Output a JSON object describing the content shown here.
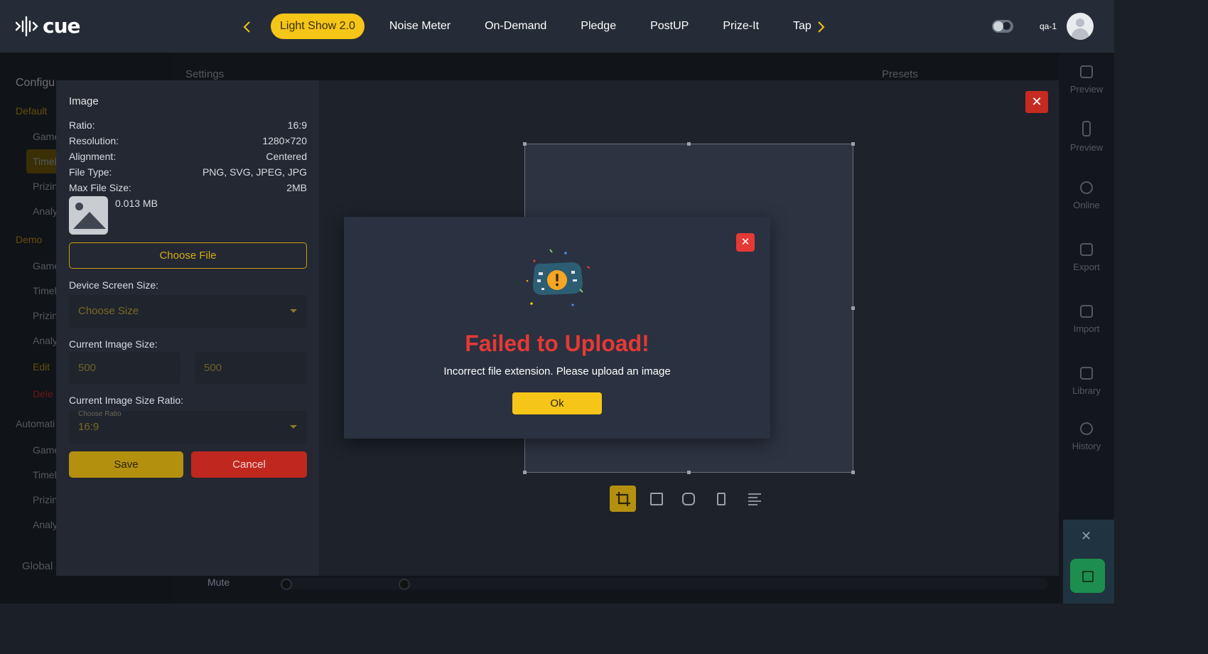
{
  "app": {
    "logo_text": "cue"
  },
  "nav": {
    "tabs": [
      {
        "label": "Light Show 2.0",
        "active": true
      },
      {
        "label": "Noise Meter"
      },
      {
        "label": "On-Demand"
      },
      {
        "label": "Pledge"
      },
      {
        "label": "PostUP"
      },
      {
        "label": "Prize-It"
      },
      {
        "label": "Tap"
      }
    ],
    "user_name": "qa-1"
  },
  "background": {
    "sidebar": {
      "title": "Configu",
      "sections": [
        "Default",
        "Demo",
        "Automati"
      ],
      "items": [
        "Game",
        "Timel",
        "Prizin",
        "Analy",
        "Game",
        "Timel",
        "Prizin",
        "Analy",
        "Edit",
        "Dele",
        "Game",
        "Timel",
        "Prizin",
        "Analy"
      ],
      "footer": "Global"
    },
    "main": {
      "settings_label": "Settings",
      "presets_label": "Presets",
      "mute_label": "Mute"
    },
    "right_panel": [
      "Preview",
      "Preview",
      "Online",
      "Export",
      "Import",
      "Library",
      "History"
    ]
  },
  "editor": {
    "title": "Image",
    "specs": [
      {
        "label": "Ratio:",
        "value": "16:9"
      },
      {
        "label": "Resolution:",
        "value": "1280×720"
      },
      {
        "label": "Alignment:",
        "value": "Centered"
      },
      {
        "label": "File Type:",
        "value": "PNG, SVG, JPEG, JPG"
      },
      {
        "label": "Max File Size:",
        "value": "2MB"
      }
    ],
    "file_size": "0.013 MB",
    "choose_file_label": "Choose File",
    "device_screen_label": "Device Screen Size:",
    "device_screen_placeholder": "Choose Size",
    "current_size_label": "Current Image Size:",
    "width_value": "500",
    "height_value": "500",
    "ratio_label": "Current Image Size Ratio:",
    "ratio_floating_label": "Choose Ratio",
    "ratio_value": "16:9",
    "save_label": "Save",
    "cancel_label": "Cancel",
    "close_glyph": "✕",
    "tools": [
      "crop-icon",
      "rotate-icon",
      "lock-aspect-icon",
      "flip-icon",
      "align-icon"
    ]
  },
  "dialog": {
    "title": "Failed to Upload!",
    "message": "Incorrect file extension. Please upload an image",
    "ok_label": "Ok",
    "close_glyph": "✕",
    "illustration": "warning-illustration-icon"
  },
  "colors": {
    "accent": "#f5c518",
    "danger": "#e53935",
    "topbar": "#252b37",
    "dialog_bg": "#2a3140"
  }
}
